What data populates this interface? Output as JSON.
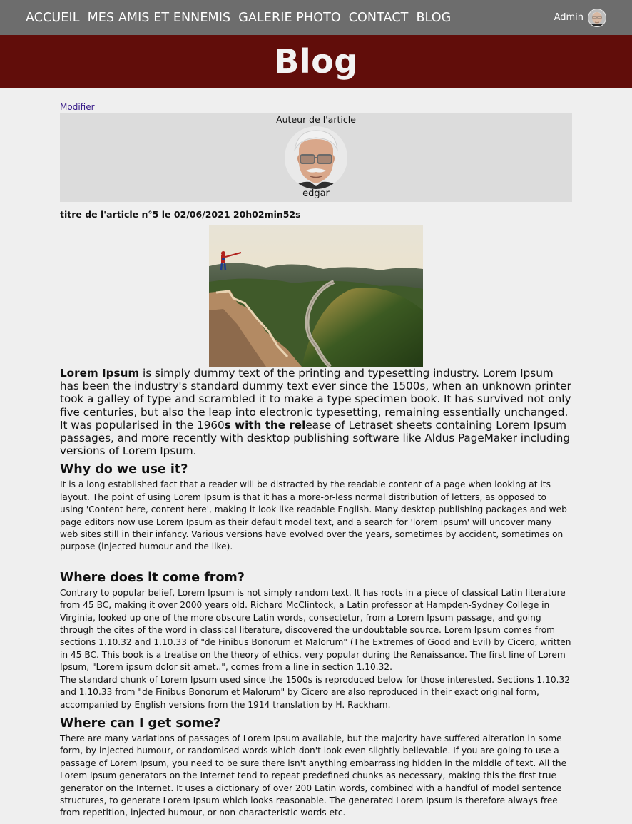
{
  "nav": {
    "links": [
      "ACCUEIL",
      "MES AMIS ET ENNEMIS",
      "GALERIE PHOTO",
      "CONTACT",
      "BLOG"
    ],
    "user_name": "Admin"
  },
  "banner": {
    "title": "Blog"
  },
  "article": {
    "edit_label": "Modifier",
    "author_caption": "Auteur de l'article",
    "author_name": "edgar",
    "title": "titre de l'article n°5 le 02/06/2021 20h02min52s",
    "intro": {
      "bold_lead": "Lorem Ipsum",
      "text_a": " is simply dummy text of the printing and typesetting industry. Lorem Ipsum has been the industry's standard dummy text ever since the 1500s, when an unknown printer took a galley of type and scrambled it to make a type specimen book. It has survived not only five centuries, but also the leap into electronic typesetting, remaining essentially unchanged. It was popularised in the 1960",
      "bold_mid": "s with the rel",
      "text_b": "ease of Letraset sheets containing Lorem Ipsum passages, and more recently with desktop publishing software like Aldus PageMaker including versions of Lorem Ipsum."
    },
    "sections": [
      {
        "heading": "Why do we use it?",
        "paragraphs": [
          "It is a long established fact that a reader will be distracted by the readable content of a page when looking at its layout. The point of using Lorem Ipsum is that it has a more-or-less normal distribution of letters, as opposed to using 'Content here, content here', making it look like readable English. Many desktop publishing packages and web page editors now use Lorem Ipsum as their default model text, and a search for 'lorem ipsum' will uncover many web sites still in their infancy. Various versions have evolved over the years, sometimes by accident, sometimes on purpose (injected humour and the like)."
        ]
      },
      {
        "heading": "Where does it come from?",
        "paragraphs": [
          "Contrary to popular belief, Lorem Ipsum is not simply random text. It has roots in a piece of classical Latin literature from 45 BC, making it over 2000 years old. Richard McClintock, a Latin professor at Hampden-Sydney College in Virginia, looked up one of the more obscure Latin words, consectetur, from a Lorem Ipsum passage, and going through the cites of the word in classical literature, discovered the undoubtable source. Lorem Ipsum comes from sections 1.10.32 and 1.10.33 of \"de Finibus Bonorum et Malorum\" (The Extremes of Good and Evil) by Cicero, written in 45 BC. This book is a treatise on the theory of ethics, very popular during the Renaissance. The first line of Lorem Ipsum, \"Lorem ipsum dolor sit amet..\", comes from a line in section 1.10.32.",
          "The standard chunk of Lorem Ipsum used since the 1500s is reproduced below for those interested. Sections 1.10.32 and 1.10.33 from \"de Finibus Bonorum et Malorum\" by Cicero are also reproduced in their exact original form, accompanied by English versions from the 1914 translation by H. Rackham."
        ]
      },
      {
        "heading": "Where can I get some?",
        "paragraphs": [
          "There are many variations of passages of Lorem Ipsum available, but the majority have suffered alteration in some form, by injected humour, or randomised words which don't look even slightly believable. If you are going to use a passage of Lorem Ipsum, you need to be sure there isn't anything embarrassing hidden in the middle of text. All the Lorem Ipsum generators on the Internet tend to repeat predefined chunks as necessary, making this the first true generator on the Internet. It uses a dictionary of over 200 Latin words, combined with a handful of model sentence structures, to generate Lorem Ipsum which looks reasonable. The generated Lorem Ipsum is therefore always free from repetition, injected humour, or non-characteristic words etc."
        ]
      }
    ]
  },
  "colors": {
    "navbar": "#6d6d6d",
    "banner": "#610d0a",
    "page_bg": "#efefef",
    "author_box": "#dcdcdc",
    "link": "#3a1e8a"
  },
  "icons": {
    "user_avatar": "user-avatar-icon",
    "author_avatar": "author-avatar-photo",
    "article_image": "great-wall-photo"
  }
}
